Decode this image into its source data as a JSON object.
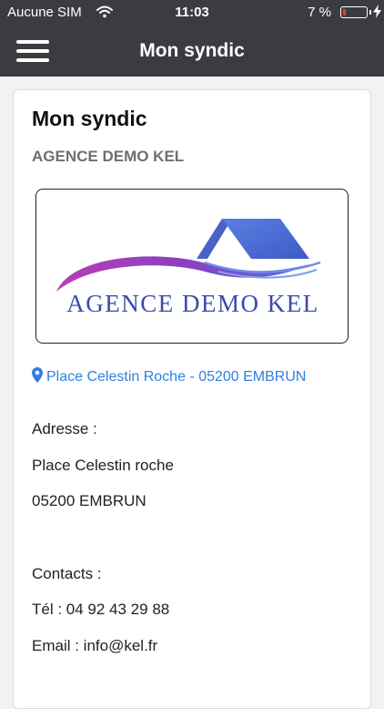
{
  "status_bar": {
    "carrier": "Aucune SIM",
    "time": "11:03",
    "battery_pct": "7 %",
    "battery_level": 0.07,
    "wifi_icon": "wifi-icon",
    "charging_icon": "bolt-icon"
  },
  "nav": {
    "title": "Mon syndic",
    "menu_icon": "hamburger-menu-icon"
  },
  "card": {
    "title": "Mon syndic",
    "subtitle": "AGENCE DEMO KEL",
    "logo_text": "AGENCE DEMO KEL",
    "address_link": "Place Celestin Roche - 05200 EMBRUN",
    "address_label": "Adresse :",
    "address_line1": "Place Celestin roche",
    "address_line2": "05200 EMBRUN",
    "contacts_label": "Contacts :",
    "phone": "Tél : 04 92 43 29 88",
    "email": "Email : info@kel.fr"
  },
  "colors": {
    "header_bg": "#3a3c40",
    "link": "#2f7fe0",
    "battery_low": "#ff3b30",
    "logo_text": "#3b4aa8"
  }
}
